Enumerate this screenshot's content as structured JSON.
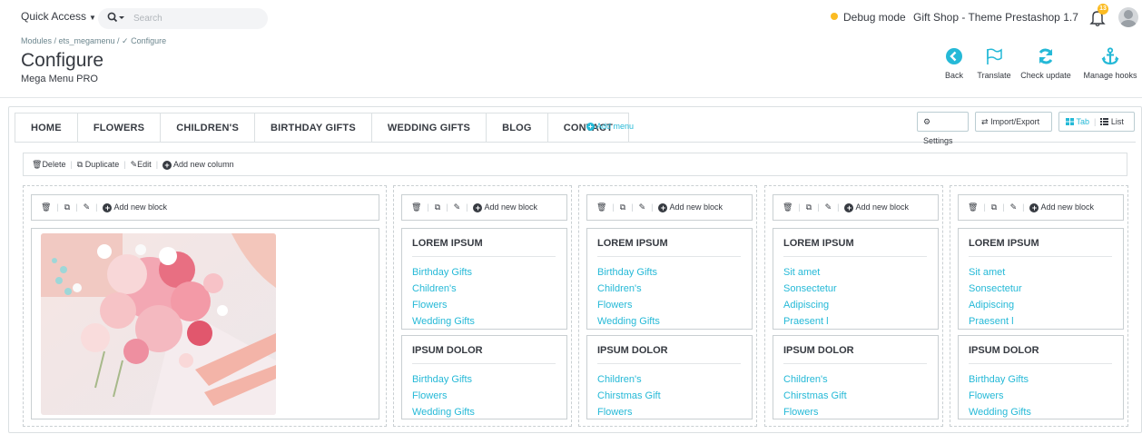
{
  "topbar": {
    "quick_access": "Quick Access",
    "search_placeholder": "Search",
    "debug_mode": "Debug mode",
    "shop_name": "Gift Shop - Theme Prestashop 1.7",
    "notification_count": "13"
  },
  "header": {
    "breadcrumb": "Modules / ets_megamenu / ✓ Configure",
    "title": "Configure",
    "subtitle": "Mega Menu PRO",
    "toolbar": {
      "back": "Back",
      "translate": "Translate",
      "check_update": "Check update",
      "manage_hooks": "Manage hooks"
    }
  },
  "menu_tabs": [
    "HOME",
    "FLOWERS",
    "CHILDREN'S",
    "BIRTHDAY GIFTS",
    "WEDDING GIFTS",
    "BLOG",
    "CONTACT"
  ],
  "active_tab": "FLOWERS",
  "add_menu": "Add menu",
  "buttons": {
    "settings": "Settings",
    "import_export": "Import/Export",
    "tab": "Tab",
    "list": "List"
  },
  "column_bar": {
    "delete": "Delete",
    "duplicate": "Duplicate",
    "edit": "Edit",
    "add_column": "Add new column"
  },
  "add_block": "Add new block",
  "columns": [
    {
      "blocks": [
        {
          "title": "LOREM IPSUM",
          "links": [
            "Birthday Gifts",
            "Children's",
            "Flowers",
            "Wedding Gifts"
          ]
        },
        {
          "title": "IPSUM DOLOR",
          "links": [
            "Birthday Gifts",
            "Flowers",
            "Wedding Gifts"
          ]
        }
      ]
    },
    {
      "blocks": [
        {
          "title": "LOREM IPSUM",
          "links": [
            "Birthday Gifts",
            "Children's",
            "Flowers",
            "Wedding Gifts"
          ]
        },
        {
          "title": "IPSUM DOLOR",
          "links": [
            "Children's",
            "Chirstmas Gift",
            "Flowers"
          ]
        }
      ]
    },
    {
      "blocks": [
        {
          "title": "LOREM IPSUM",
          "links": [
            "Sit amet",
            "Sonsectetur",
            "Adipiscing",
            "Praesent l"
          ]
        },
        {
          "title": "IPSUM DOLOR",
          "links": [
            "Children's",
            "Chirstmas Gift",
            "Flowers"
          ]
        }
      ]
    },
    {
      "blocks": [
        {
          "title": "LOREM IPSUM",
          "links": [
            "Sit amet",
            "Sonsectetur",
            "Adipiscing",
            "Praesent l"
          ]
        },
        {
          "title": "IPSUM DOLOR",
          "links": [
            "Birthday Gifts",
            "Flowers",
            "Wedding Gifts"
          ]
        }
      ]
    }
  ],
  "colors": {
    "accent": "#25b9d7",
    "text": "#363a41",
    "debug_dot": "#fbbb22"
  }
}
